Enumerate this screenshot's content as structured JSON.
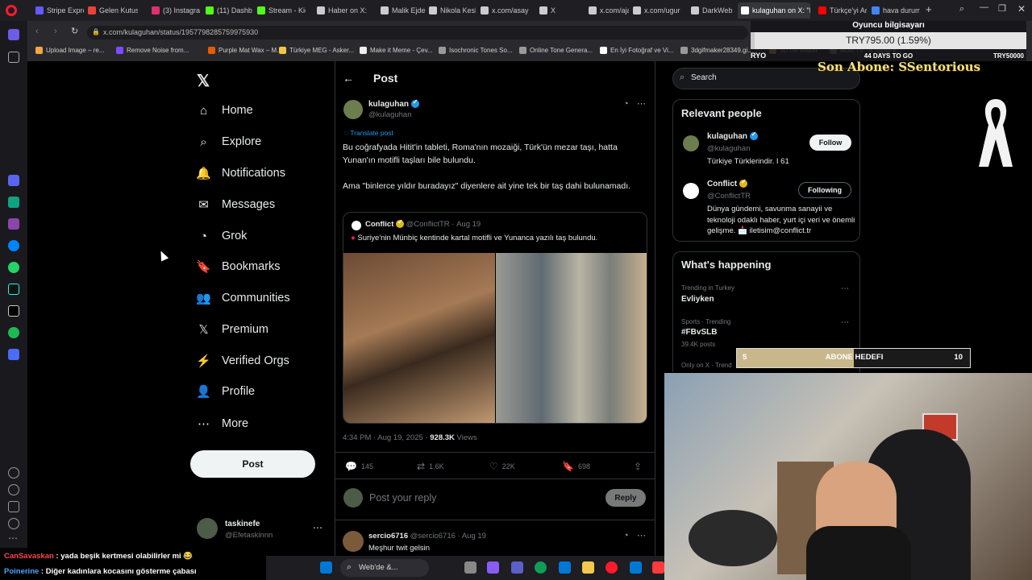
{
  "browser": {
    "tabs": [
      {
        "title": "Stripe Expres",
        "color": "#635bff"
      },
      {
        "title": "Gelen Kutusu",
        "color": "#ea4335"
      },
      {
        "title": "(3) Instagram",
        "color": "#e1306c"
      },
      {
        "title": "(11) Dashboa",
        "color": "#53fc18"
      },
      {
        "title": "Stream - Kic",
        "color": "#53fc18"
      },
      {
        "title": "Haber on X:",
        "color": "#cccccc"
      },
      {
        "title": "Malik Ejder o",
        "color": "#cccccc"
      },
      {
        "title": "Nikola Kesla",
        "color": "#cccccc"
      },
      {
        "title": "x.com/asayi",
        "color": "#cccccc"
      },
      {
        "title": "X",
        "color": "#cccccc"
      },
      {
        "title": "x.com/ajans",
        "color": "#cccccc"
      },
      {
        "title": "x.com/ugur",
        "color": "#cccccc"
      },
      {
        "title": "DarkWeb H",
        "color": "#cccccc"
      },
      {
        "title": "kulaguhan on X: \"Bu",
        "color": "#ffffff"
      },
      {
        "title": "Türkçe'yi An",
        "color": "#ff0000"
      },
      {
        "title": "hava durum",
        "color": "#4285f4"
      }
    ],
    "url": "x.com/kulaguhan/status/1957798285759975930",
    "bookmarks": [
      {
        "label": "Upload Image – re...",
        "color": "#f4a742"
      },
      {
        "label": "Remove Noise from...",
        "color": "#7b4dff"
      },
      {
        "label": "Purple Mat Wax – M...",
        "color": "#e65c00"
      },
      {
        "label": "Türkiye MEG - Asker...",
        "color": "#f4c542"
      },
      {
        "label": "Make it Meme - Çev...",
        "color": "#eeeeee"
      },
      {
        "label": "Isochronic Tones So...",
        "color": "#999999"
      },
      {
        "label": "Online Tone Genera...",
        "color": "#999999"
      },
      {
        "label": "En İyi Fotoğraf ve Vi...",
        "color": "#ffffff"
      },
      {
        "label": "3dgifmaker28349.gi...",
        "color": "#999999"
      },
      {
        "label": "3D Gif Maker",
        "color": "#f4c542"
      },
      {
        "label": "Multi TV - 8 haber k...",
        "color": "#999999"
      }
    ]
  },
  "nav": {
    "items": [
      {
        "label": "Home",
        "icon": "⌂"
      },
      {
        "label": "Explore",
        "icon": "⌕"
      },
      {
        "label": "Notifications",
        "icon": "🔔"
      },
      {
        "label": "Messages",
        "icon": "✉"
      },
      {
        "label": "Grok",
        "icon": "◔"
      },
      {
        "label": "Bookmarks",
        "icon": "🔖"
      },
      {
        "label": "Communities",
        "icon": "👥"
      },
      {
        "label": "Premium",
        "icon": "𝕏"
      },
      {
        "label": "Verified Orgs",
        "icon": "⚡"
      },
      {
        "label": "Profile",
        "icon": "👤"
      },
      {
        "label": "More",
        "icon": "⋯"
      }
    ],
    "post_label": "Post",
    "account": {
      "name": "taskinefe",
      "handle": "@Efetaskinnn"
    }
  },
  "post": {
    "header": "Post",
    "author": {
      "name": "kulaguhan",
      "handle": "@kulaguhan"
    },
    "translate": "Translate post",
    "text1": "Bu coğrafyada Hitit'in tableti, Roma'nın mozaiği, Türk'ün mezar taşı, hatta Yunan'ın motifli taşları bile bulundu.",
    "text2": "Ama \"binlerce yıldır buradayız\" diyenlere ait yine tek bir taş dahi bulunamadı.",
    "quote": {
      "name": "Conflict",
      "handle": "@ConflictTR",
      "date": "Aug 19",
      "text": "Suriye'nin Münbiç kentinde kartal motifli ve Yunanca yazılı taş bulundu."
    },
    "time": "4:34 PM · Aug 19, 2025 ·",
    "views": "928.3K",
    "views_label": "Views",
    "stats": {
      "replies": "145",
      "reposts": "1.6K",
      "likes": "22K",
      "bookmarks": "698"
    },
    "reply_placeholder": "Post your reply",
    "reply_label": "Reply",
    "reply1": {
      "name": "sercio6716",
      "handle": "@sercio6716",
      "date": "Aug 19",
      "text": "Meşhur twit gelsin"
    }
  },
  "right": {
    "search_placeholder": "Search",
    "relevant_title": "Relevant people",
    "people": [
      {
        "name": "kulaguhan",
        "handle": "@kulaguhan",
        "bio": "Türkiye Türklerindir. I 61",
        "button": "Follow"
      },
      {
        "name": "Conflict",
        "handle": "@ConflictTR",
        "bio": "Dünya gündemi, savunma sanayii ve teknoloji odaklı haber, yurt içi veri ve önemli gelişme. 📩 iletisim@conflict.tr",
        "button": "Following"
      }
    ],
    "happening_title": "What's happening",
    "trends": [
      {
        "context": "Trending in Turkey",
        "topic": "Evliyken",
        "posts": ""
      },
      {
        "context": "Sports · Trending",
        "topic": "#FBvSLB",
        "posts": "39.4K posts"
      },
      {
        "context": "Only on X · Trend",
        "topic": "",
        "posts": ""
      }
    ]
  },
  "overlay": {
    "price_title": "Oyuncu bilgisayarı",
    "price": "TRY795.00 (1.59%)",
    "left_label": "RYO",
    "days": "44 DAYS TO GO",
    "right_label": "TRY50000",
    "price_progress": 0.0159,
    "last_sub": "Son Abone: SSentorious",
    "goal_current": "5",
    "goal_label": "ABONE HEDEFI",
    "goal_target": "10",
    "goal_progress": 0.5
  },
  "chat": [
    {
      "user": "CanSavaskan",
      "message": "yada beşik kertmesi olabilirler mi 😂",
      "color": "#ff4444"
    },
    {
      "user": "Poinerine",
      "message": "Diğer kadınlara kocasını gösterme çabası",
      "color": "#4aa3ff"
    }
  ],
  "taskbar": {
    "search_label": "Web'de &..."
  }
}
